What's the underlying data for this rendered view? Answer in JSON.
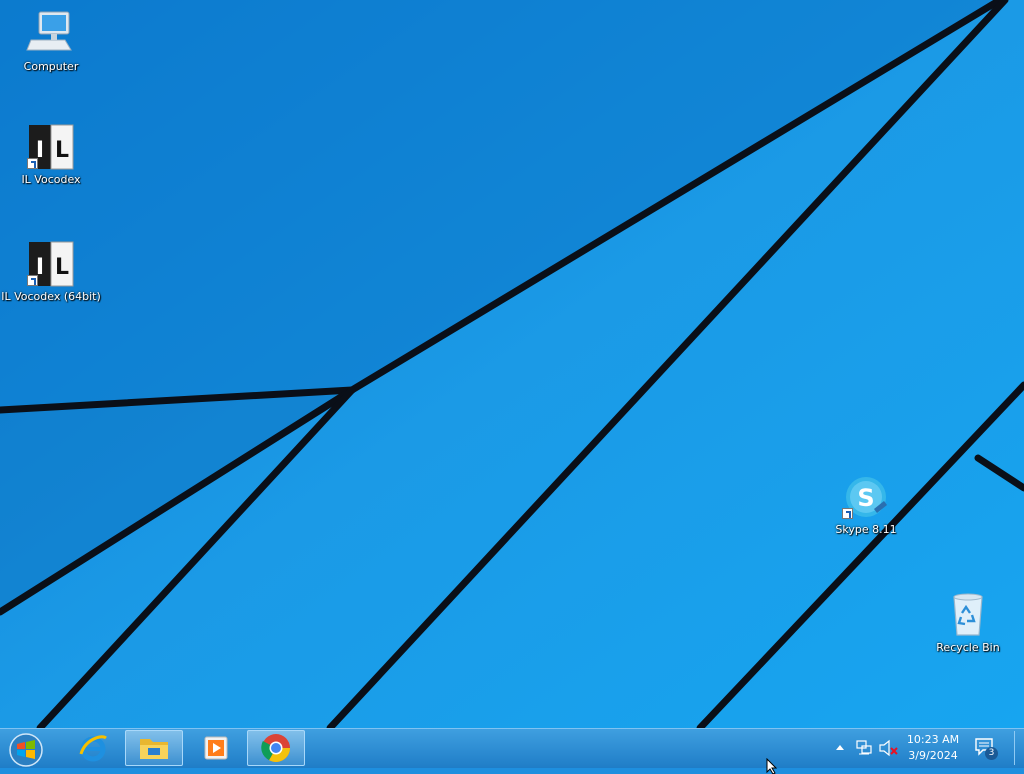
{
  "desktop": {
    "icons": [
      {
        "name": "computer",
        "label": "Computer",
        "icon": "computer-icon"
      },
      {
        "name": "il-vocodex",
        "label": "IL Vocodex",
        "icon": "il-vocodex-icon"
      },
      {
        "name": "il-vocodex-64",
        "label": "IL Vocodex (64bit)",
        "icon": "il-vocodex-icon"
      },
      {
        "name": "skype",
        "label": "Skype 8.11",
        "icon": "skype-icon"
      },
      {
        "name": "recycle-bin",
        "label": "Recycle Bin",
        "icon": "recycle-bin-icon"
      }
    ]
  },
  "taskbar": {
    "pinned": [
      {
        "name": "internet-explorer",
        "icon": "internet-explorer-icon"
      },
      {
        "name": "file-explorer",
        "icon": "folder-icon"
      },
      {
        "name": "media-player",
        "icon": "media-player-icon"
      },
      {
        "name": "chrome",
        "icon": "chrome-icon"
      }
    ],
    "clock": {
      "time": "10:23 AM",
      "date": "3/9/2024"
    },
    "notifications": {
      "count": "3"
    }
  },
  "colors": {
    "wallpaper": "#1e8fdf",
    "taskbar": "#2b8ad4",
    "accent": "#0a6cc2"
  }
}
